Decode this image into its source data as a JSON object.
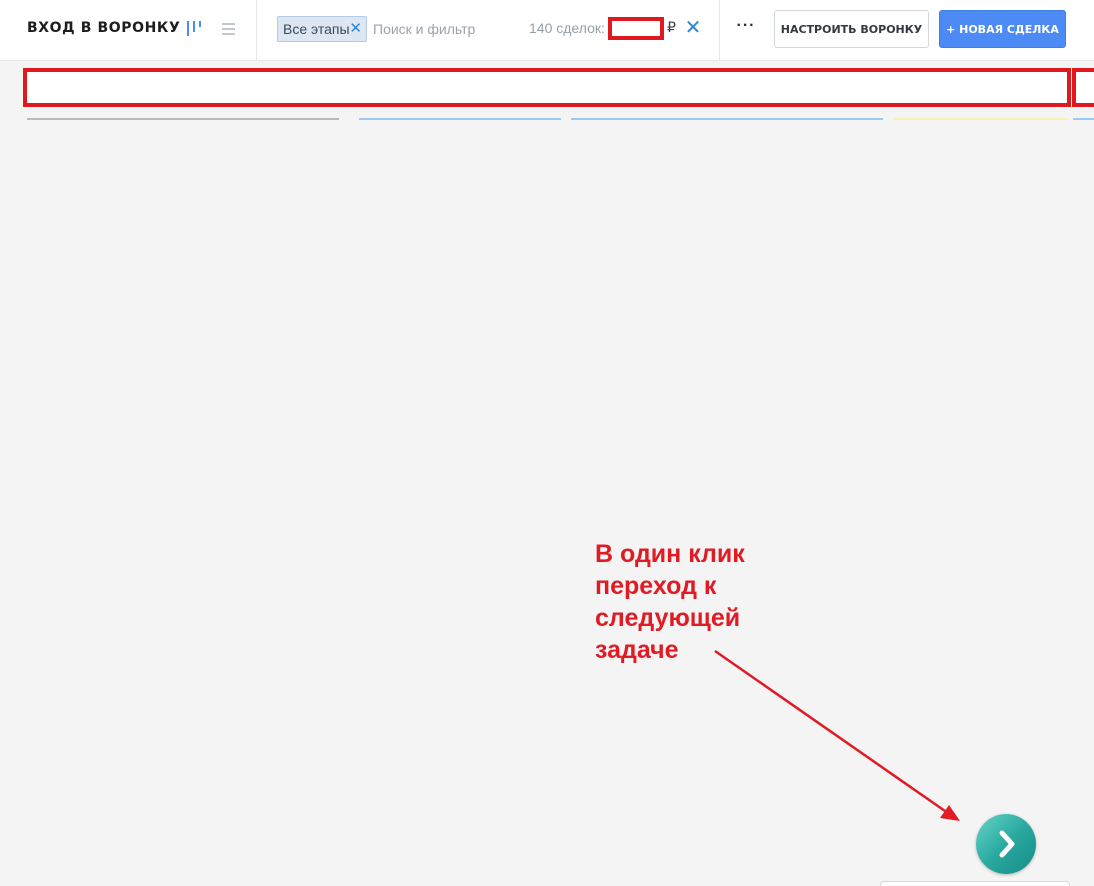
{
  "header": {
    "title": "ВХОД В ВОРОНКУ",
    "filter_tag": "Все этапы",
    "search_placeholder": "Поиск и фильтр",
    "deals_count": "140 сделок:",
    "currency": "₽",
    "clear_icon": "close-icon",
    "more_label": "···",
    "config_button": "НАСТРОИТЬ ВОРОНКУ",
    "new_deal_button": "+ НОВАЯ СДЕЛКА"
  },
  "stage_bars": [
    {
      "color": "#b7babe"
    },
    {
      "color": "#9ec9f0"
    },
    {
      "color": "#9ec9f0"
    },
    {
      "color": "#fbf1b0"
    },
    {
      "color": "#9ec9f0"
    }
  ],
  "annotation": {
    "lines": [
      "В один клик",
      "переход к",
      "следующей",
      "задаче"
    ]
  },
  "colors": {
    "accent": "#4c8bf5",
    "annotation_red": "#e01b24",
    "next_button": "#2aa9a0"
  },
  "next_task_icon": "chevron-right-icon"
}
